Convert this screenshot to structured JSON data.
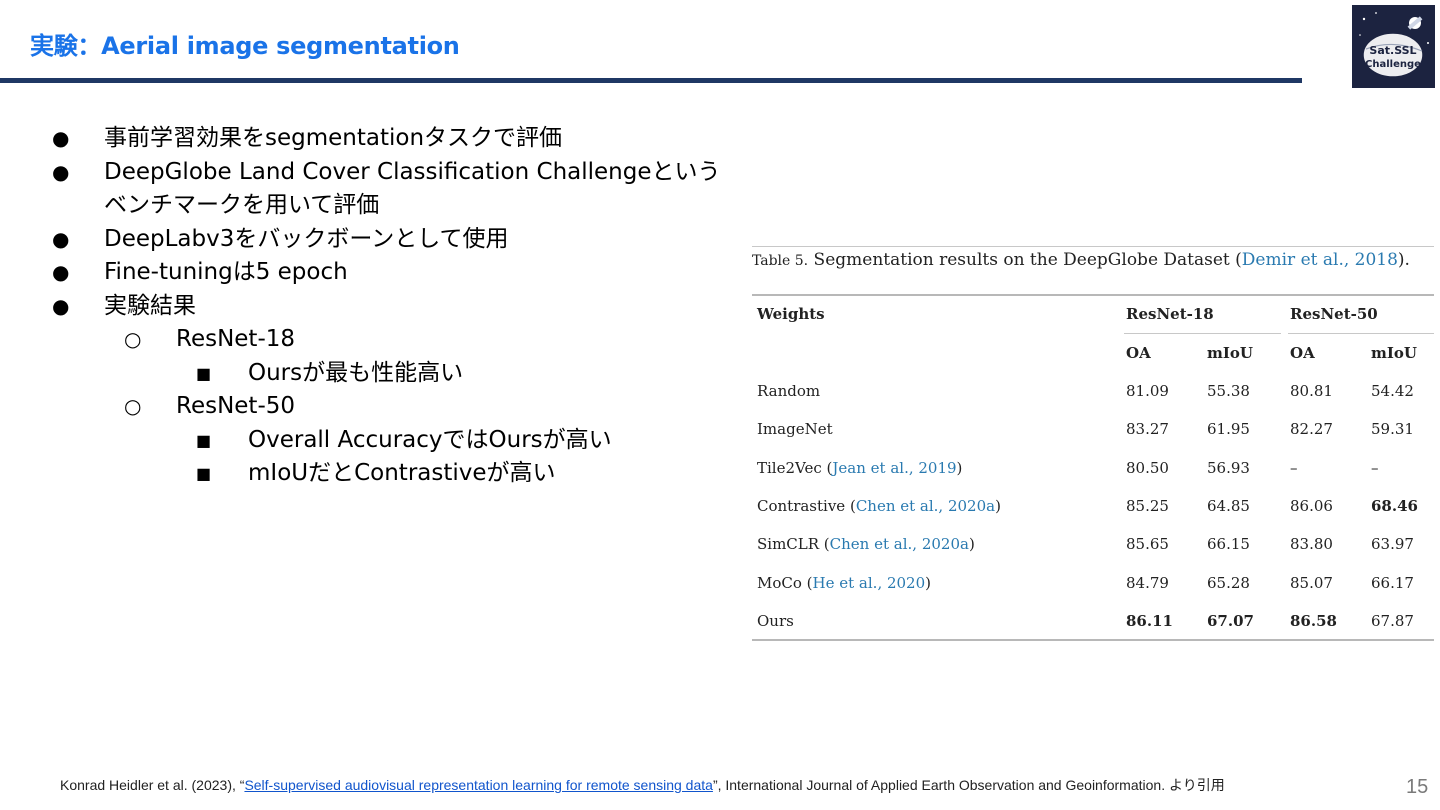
{
  "slide": {
    "title": "実験：Aerial image segmentation",
    "page_number": "15",
    "logo_text": "Sat.SSL Challenge",
    "logo_lines": [
      "Sat.SSL",
      "Challenge"
    ]
  },
  "bullets": [
    {
      "level": 1,
      "marker": "●",
      "text": "事前学習効果をsegmentationタスクで評価"
    },
    {
      "level": 1,
      "marker": "●",
      "text": "DeepGlobe Land Cover Classification Challengeというベンチマークを用いて評価"
    },
    {
      "level": 1,
      "marker": "●",
      "text": "DeepLabv3をバックボーンとして使用"
    },
    {
      "level": 1,
      "marker": "●",
      "text": "Fine-tuningは5 epoch"
    },
    {
      "level": 1,
      "marker": "●",
      "text": "実験結果"
    },
    {
      "level": 2,
      "marker": "○",
      "text": "ResNet-18"
    },
    {
      "level": 3,
      "marker": "■",
      "text": "Oursが最も性能高い"
    },
    {
      "level": 2,
      "marker": "○",
      "text": "ResNet-50"
    },
    {
      "level": 3,
      "marker": "■",
      "text": "Overall AccuracyではOursが高い"
    },
    {
      "level": 3,
      "marker": "■",
      "text": "mIoUだとContrastiveが高い"
    }
  ],
  "table": {
    "caption_label": "Table 5.",
    "caption_text": "Segmentation results on the DeepGlobe Dataset (",
    "caption_cite": "Demir et al., 2018",
    "caption_end": ").",
    "col_weights": "Weights",
    "group_18": "ResNet-18",
    "group_50": "ResNet-50",
    "sub_oa": "OA",
    "sub_miou": "mIoU",
    "rows": [
      {
        "name": "Random",
        "cite": "",
        "v": [
          "81.09",
          "55.38",
          "80.81",
          "54.42"
        ],
        "bold": [
          false,
          false,
          false,
          false
        ]
      },
      {
        "name": "ImageNet",
        "cite": "",
        "v": [
          "83.27",
          "61.95",
          "82.27",
          "59.31"
        ],
        "bold": [
          false,
          false,
          false,
          false
        ]
      },
      {
        "name": "Tile2Vec",
        "cite": "Jean et al., 2019",
        "v": [
          "80.50",
          "56.93",
          "–",
          "–"
        ],
        "bold": [
          false,
          false,
          false,
          false
        ]
      },
      {
        "name": "Contrastive",
        "cite": "Chen et al., 2020a",
        "v": [
          "85.25",
          "64.85",
          "86.06",
          "68.46"
        ],
        "bold": [
          false,
          false,
          false,
          true
        ]
      },
      {
        "name": "SimCLR",
        "cite": "Chen et al., 2020a",
        "v": [
          "85.65",
          "66.15",
          "83.80",
          "63.97"
        ],
        "bold": [
          false,
          false,
          false,
          false
        ]
      },
      {
        "name": "MoCo",
        "cite": "He et al., 2020",
        "v": [
          "84.79",
          "65.28",
          "85.07",
          "66.17"
        ],
        "bold": [
          false,
          false,
          false,
          false
        ]
      },
      {
        "name": "Ours",
        "cite": "",
        "v": [
          "86.11",
          "67.07",
          "86.58",
          "67.87"
        ],
        "bold": [
          true,
          true,
          true,
          false
        ]
      }
    ]
  },
  "footer": {
    "prefix": "Konrad Heidler et al. (2023), “",
    "link_text": "Self-supervised audiovisual representation learning for remote sensing data",
    "suffix": "”, International Journal of Applied Earth Observation and Geoinformation. より引用"
  },
  "colors": {
    "title": "#1a73e8",
    "title_rule": "#1f3864",
    "logo_bg": "#1c2340",
    "cite": "#2a7ab0",
    "link": "#1155cc"
  }
}
